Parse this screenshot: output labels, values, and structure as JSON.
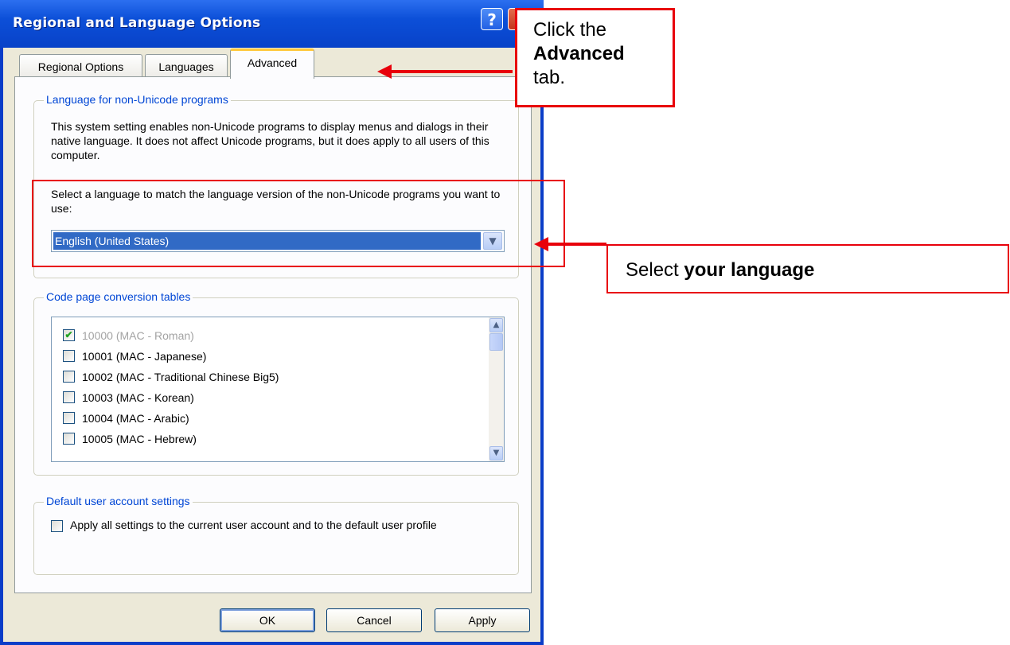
{
  "window": {
    "title": "Regional and Language Options",
    "help_glyph": "?"
  },
  "tabs": [
    {
      "label": "Regional Options",
      "selected": false
    },
    {
      "label": "Languages",
      "selected": false
    },
    {
      "label": "Advanced",
      "selected": true
    }
  ],
  "non_unicode": {
    "legend": "Language for non-Unicode programs",
    "description": "This system setting enables non-Unicode programs to display menus and dialogs in their native language. It does not affect Unicode programs, but it does apply to all users of this computer.",
    "select_prompt": "Select a language to match the language version of the non-Unicode programs you want to use:",
    "selected_language": "English (United States)"
  },
  "code_pages": {
    "legend": "Code page conversion tables",
    "items": [
      {
        "label": "10000 (MAC - Roman)",
        "checked": true,
        "disabled": true
      },
      {
        "label": "10001 (MAC - Japanese)",
        "checked": false,
        "disabled": false
      },
      {
        "label": "10002 (MAC - Traditional Chinese Big5)",
        "checked": false,
        "disabled": false
      },
      {
        "label": "10003 (MAC - Korean)",
        "checked": false,
        "disabled": false
      },
      {
        "label": "10004 (MAC - Arabic)",
        "checked": false,
        "disabled": false
      },
      {
        "label": "10005 (MAC - Hebrew)",
        "checked": false,
        "disabled": false
      }
    ]
  },
  "default_user": {
    "legend": "Default user account settings",
    "checkbox_label": "Apply all settings to the current user account and to the default user profile",
    "checked": false
  },
  "buttons": {
    "ok": "OK",
    "cancel": "Cancel",
    "apply": "Apply"
  },
  "annotations": {
    "tab_callout_line1": "Click the",
    "tab_callout_bold": "Advanced",
    "tab_callout_line3": "tab.",
    "language_callout_prefix": "Select ",
    "language_callout_bold": "your language",
    "accent_color": "#e8000b"
  }
}
